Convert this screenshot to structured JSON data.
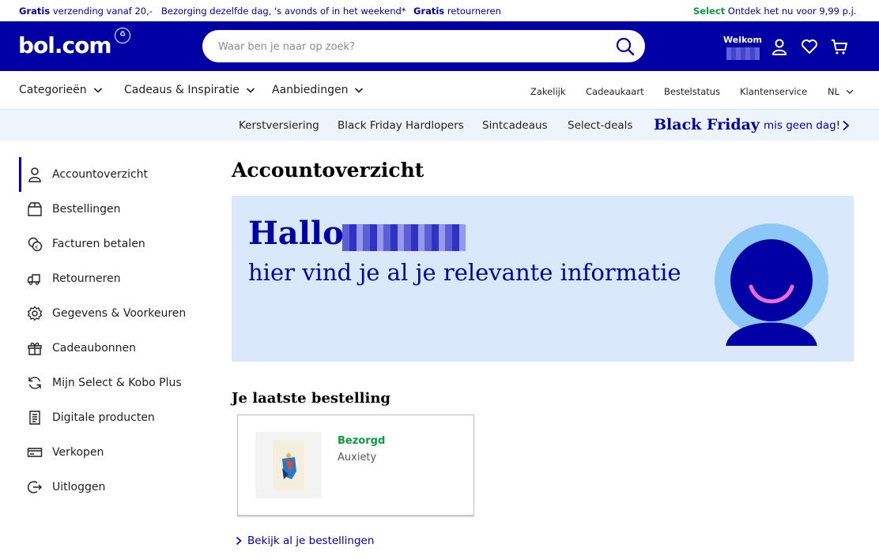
{
  "usp": {
    "shipping_bold": "Gratis",
    "shipping_rest": "verzending vanaf 20,-",
    "delivery": "Bezorging dezelfde dag, 's avonds of in het weekend*",
    "returns_bold": "Gratis",
    "returns_rest": "retourneren",
    "select_bold": "Select",
    "select_rest": "Ontdek het nu voor 9,99 p.j."
  },
  "header": {
    "logo": "bol.com",
    "search_placeholder": "Waar ben je naar op zoek?",
    "welcome": "Welkom"
  },
  "nav": {
    "main": [
      "Categorieën",
      "Cadeaus & Inspiratie",
      "Aanbiedingen"
    ],
    "utility": [
      "Zakelijk",
      "Cadeaukaart",
      "Bestelstatus",
      "Klantenservice"
    ],
    "language": "NL"
  },
  "promo": {
    "links": [
      "Kerstversiering",
      "Black Friday Hardlopers",
      "Sintcadeaus",
      "Select-deals"
    ],
    "black_friday": "Black Friday",
    "miss": "mis geen dag!"
  },
  "sidebar": {
    "items": [
      {
        "label": "Accountoverzicht",
        "icon": "user-icon",
        "active": true
      },
      {
        "label": "Bestellingen",
        "icon": "package-icon"
      },
      {
        "label": "Facturen betalen",
        "icon": "coins-icon"
      },
      {
        "label": "Retourneren",
        "icon": "return-truck-icon"
      },
      {
        "label": "Gegevens & Voorkeuren",
        "icon": "gear-icon"
      },
      {
        "label": "Cadeaubonnen",
        "icon": "gift-icon"
      },
      {
        "label": "Mijn Select & Kobo Plus",
        "icon": "refresh-icon"
      },
      {
        "label": "Digitale producten",
        "icon": "document-icon"
      },
      {
        "label": "Verkopen",
        "icon": "card-icon"
      },
      {
        "label": "Uitloggen",
        "icon": "logout-icon"
      }
    ]
  },
  "main": {
    "title": "Accountoverzicht",
    "hero_hello": "Hallo",
    "hero_sub": "hier vind je al je relevante informatie",
    "last_order_title": "Je laatste bestelling",
    "order": {
      "status": "Bezorgd",
      "name": "Auxiety"
    },
    "all_orders_link": "Bekijk al je bestellingen"
  },
  "colors": {
    "brand": "#0000a4",
    "success": "#0a9a3f",
    "hero_bg": "#d9e8fb"
  }
}
